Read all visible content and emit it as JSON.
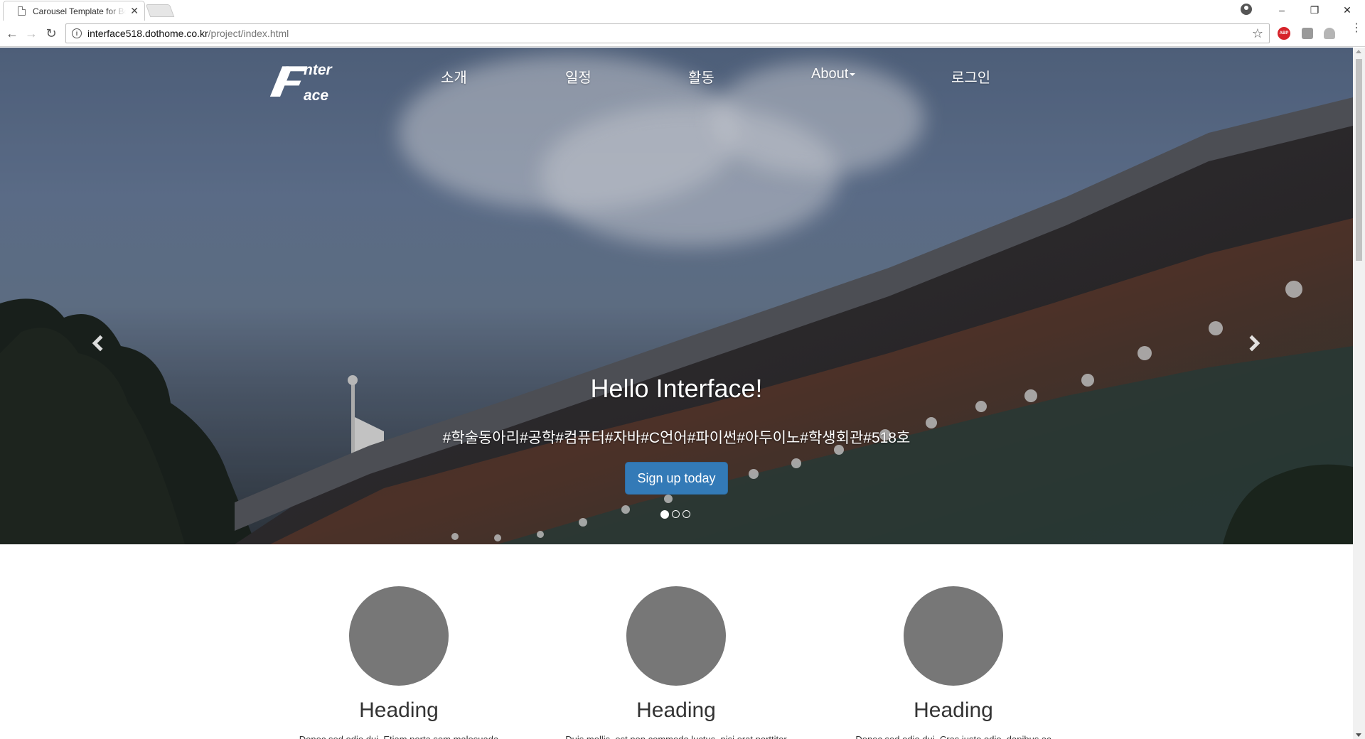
{
  "browser": {
    "tab_title": "Carousel Template for Bootstrap",
    "url_host": "interface518.dothome.co.kr",
    "url_path": "/project/index.html",
    "minimize": "–",
    "restore": "❐",
    "close": "✕",
    "tab_close": "✕",
    "back": "←",
    "forward": "→",
    "reload": "↻",
    "info": "i",
    "star": "☆",
    "extensions": [
      "abp-icon",
      "extension-icon",
      "extension-icon-2",
      "menu-icon"
    ],
    "abp_label": "ABP"
  },
  "site": {
    "logo": {
      "big": "IF",
      "nter": "nter",
      "ace": "ace"
    },
    "nav": [
      "소개",
      "일정",
      "활동",
      "About",
      "로그인"
    ]
  },
  "carousel": {
    "title": "Hello Interface!",
    "tags": "#학술동아리#공학#컴퓨터#자바#C언어#파이썬#아두이노#학생회관#518호",
    "button": "Sign up today",
    "slides": 3,
    "active_slide": 1
  },
  "features": [
    {
      "heading": "Heading",
      "text": "Donec sed odio dui. Etiam porta sem malesuada"
    },
    {
      "heading": "Heading",
      "text": "Duis mollis, est non commodo luctus, nisi erat porttitor"
    },
    {
      "heading": "Heading",
      "text": "Donec sed odio dui. Cras justo odio, dapibus ac"
    }
  ],
  "colors": {
    "primary_button": "#337ab7",
    "placeholder_circle": "#777777"
  }
}
